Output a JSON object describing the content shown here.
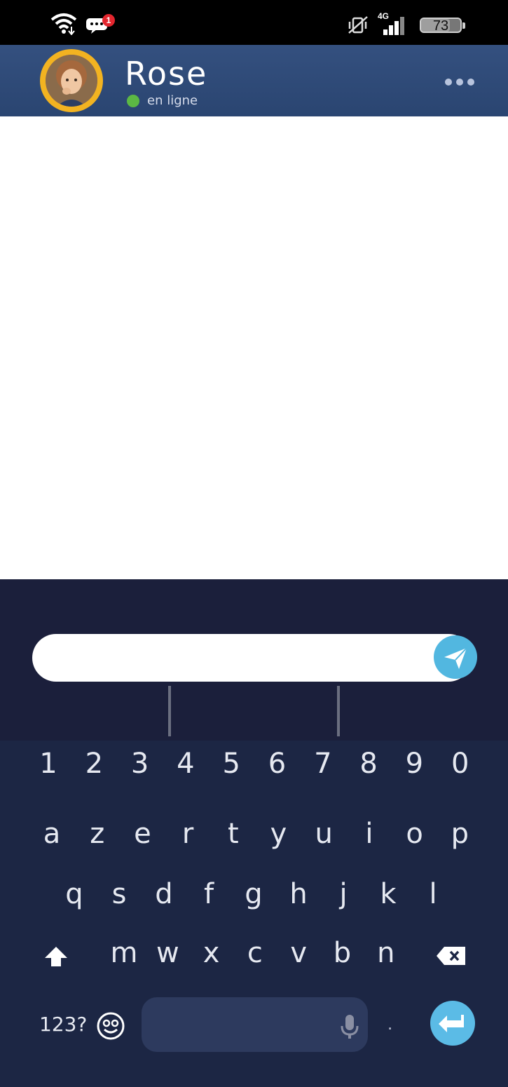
{
  "status_bar": {
    "notification_count": "1",
    "network_type": "4G",
    "battery_level": "73",
    "battery_fraction": 0.73,
    "icons": [
      "wifi-icon",
      "message-notification-icon",
      "vibrate-off-icon",
      "signal-icon",
      "battery-icon"
    ]
  },
  "header": {
    "contact_name": "Rose",
    "presence_status": "en ligne",
    "presence_color": "#5cb844",
    "avatar_ring_color": "#f2b321",
    "menu_icon": "more-horizontal-icon"
  },
  "compose": {
    "message_value": "",
    "send_icon": "send-icon",
    "send_color": "#52b7e0"
  },
  "keyboard": {
    "number_row": [
      "1",
      "2",
      "3",
      "4",
      "5",
      "6",
      "7",
      "8",
      "9",
      "0"
    ],
    "row1": [
      "a",
      "z",
      "e",
      "r",
      "t",
      "y",
      "u",
      "i",
      "o",
      "p"
    ],
    "row2": [
      "q",
      "s",
      "d",
      "f",
      "g",
      "h",
      "j",
      "k",
      "l"
    ],
    "row3": [
      "m",
      "w",
      "x",
      "c",
      "v",
      "b",
      "n"
    ],
    "symbols_key": "123?",
    "period_key": ".",
    "icons": [
      "shift-icon",
      "backspace-icon",
      "emoji-icon",
      "microphone-icon",
      "enter-icon"
    ]
  },
  "colors": {
    "header_bg": "#2f4a78",
    "compose_bg": "#1b1f3b",
    "keyboard_bg": "#1c2644",
    "accent": "#5bbbe6"
  }
}
